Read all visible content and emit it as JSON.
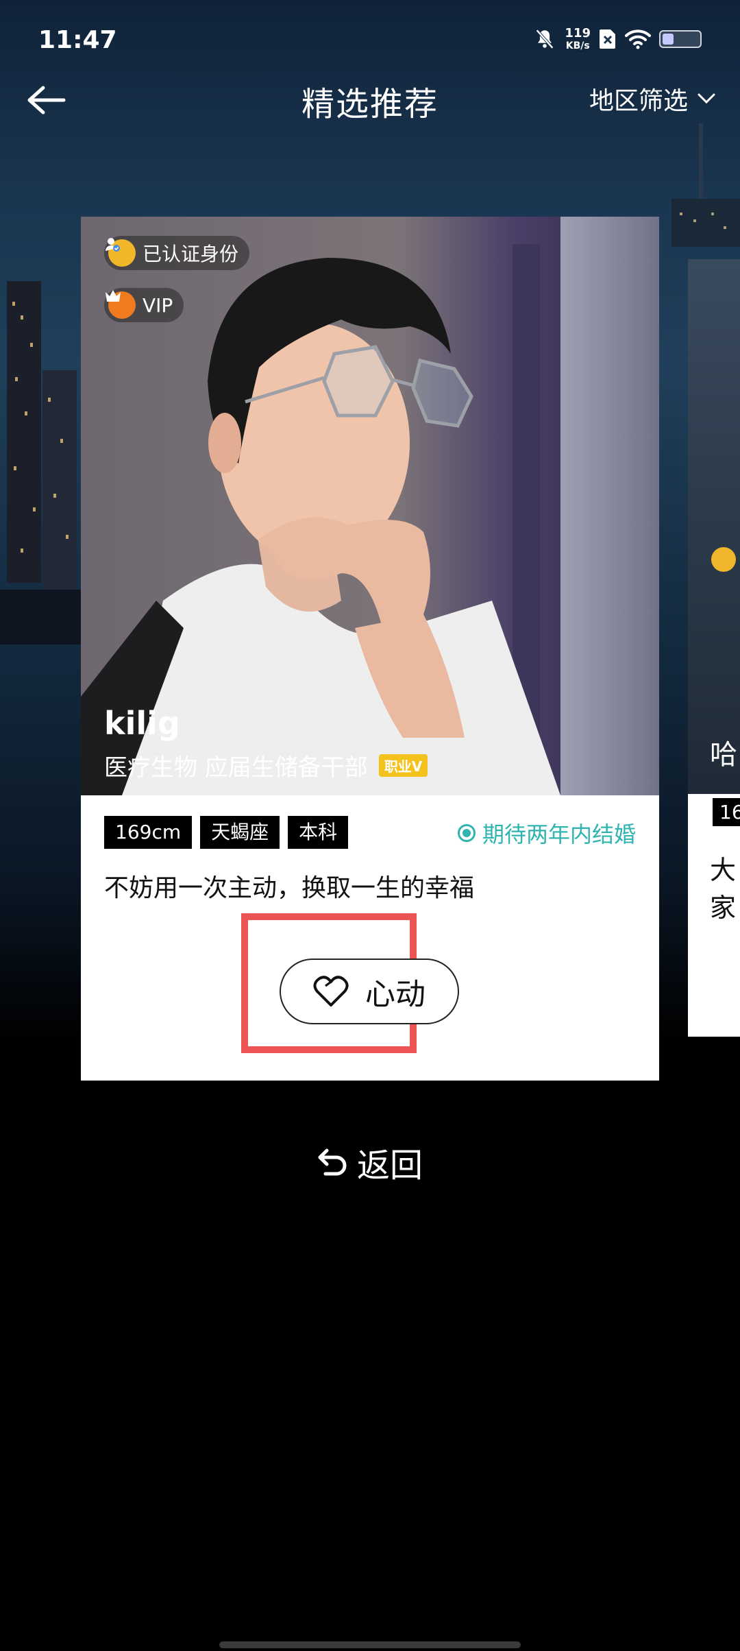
{
  "status_bar": {
    "time": "11:47",
    "net_speed": "119",
    "net_unit": "KB/s",
    "battery_level": 0.3
  },
  "header": {
    "title": "精选推荐",
    "filter_label": "地区筛选"
  },
  "card": {
    "verified_label": "已认证身份",
    "vip_label": "VIP",
    "name": "kilig",
    "job": "医疗生物 应届生储备干部",
    "job_badge": "职业V",
    "tags": [
      "169cm",
      "天蝎座",
      "本科"
    ],
    "expectation": "期待两年内结婚",
    "motto": "不妨用一次主动，换取一生的幸福",
    "like_label": "心动"
  },
  "peek_card": {
    "name": "哈",
    "tag": "16",
    "text": "大家"
  },
  "return_label": "返回",
  "colors": {
    "teal": "#2fb4b0",
    "highlight": "#ec5454",
    "badge_gold": "#f4c21c"
  }
}
